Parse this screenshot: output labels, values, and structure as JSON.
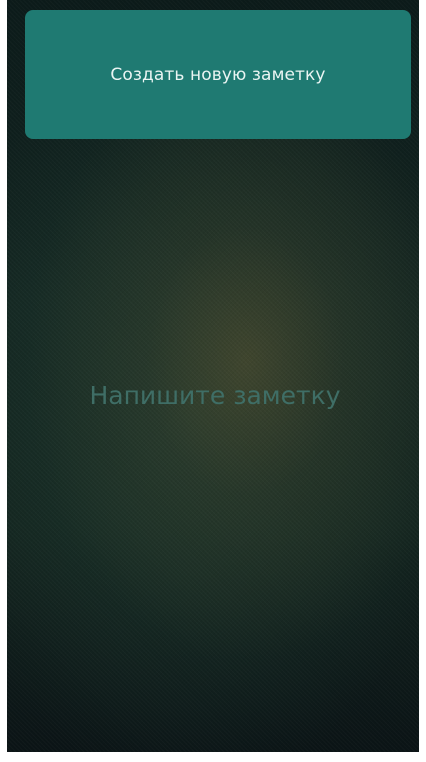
{
  "header": {
    "create_button_label": "Создать новую заметку"
  },
  "editor": {
    "note_value": "",
    "note_placeholder": "Напишите заметку"
  },
  "colors": {
    "accent": "#1f7a72",
    "background_dark": "#0c1b1a",
    "placeholder": "#3f6e66"
  }
}
